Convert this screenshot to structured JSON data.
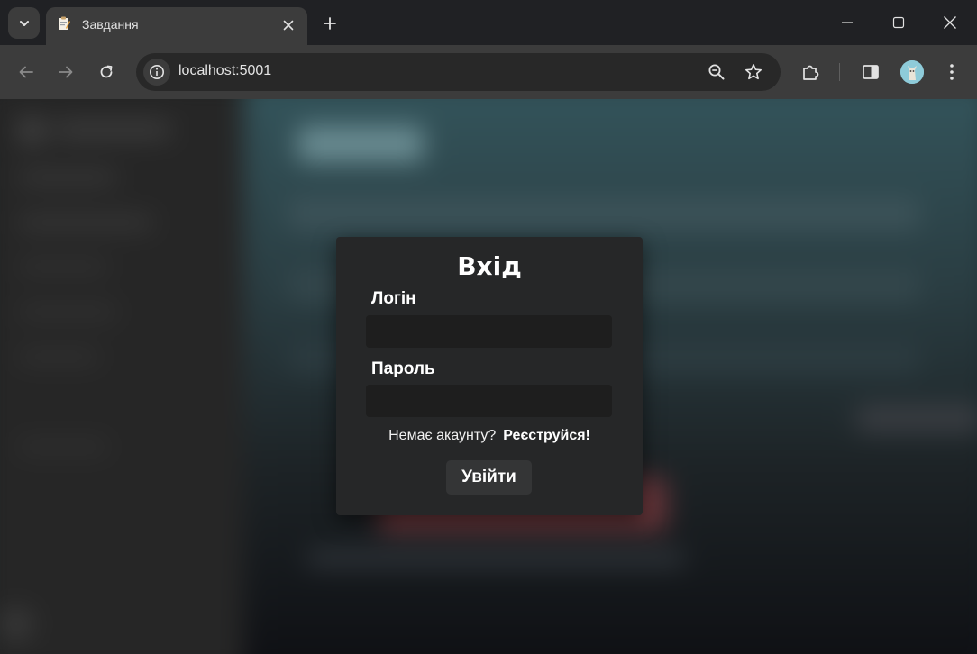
{
  "browser": {
    "tab_title": "Завдання",
    "url": "localhost:5001",
    "theme_colors": {
      "titlebar": "#202124",
      "toolbar": "#3c3c3c",
      "omnibox": "#282828"
    }
  },
  "modal": {
    "title": "Вхід",
    "login_label": "Логін",
    "login_value": "",
    "password_label": "Пароль",
    "password_value": "",
    "no_account_text": "Немає акаунту?",
    "register_link": "Реєструйся!",
    "submit_label": "Увійти",
    "colors": {
      "background": "#262728",
      "input": "#1e1e1e",
      "button": "#343536"
    }
  }
}
